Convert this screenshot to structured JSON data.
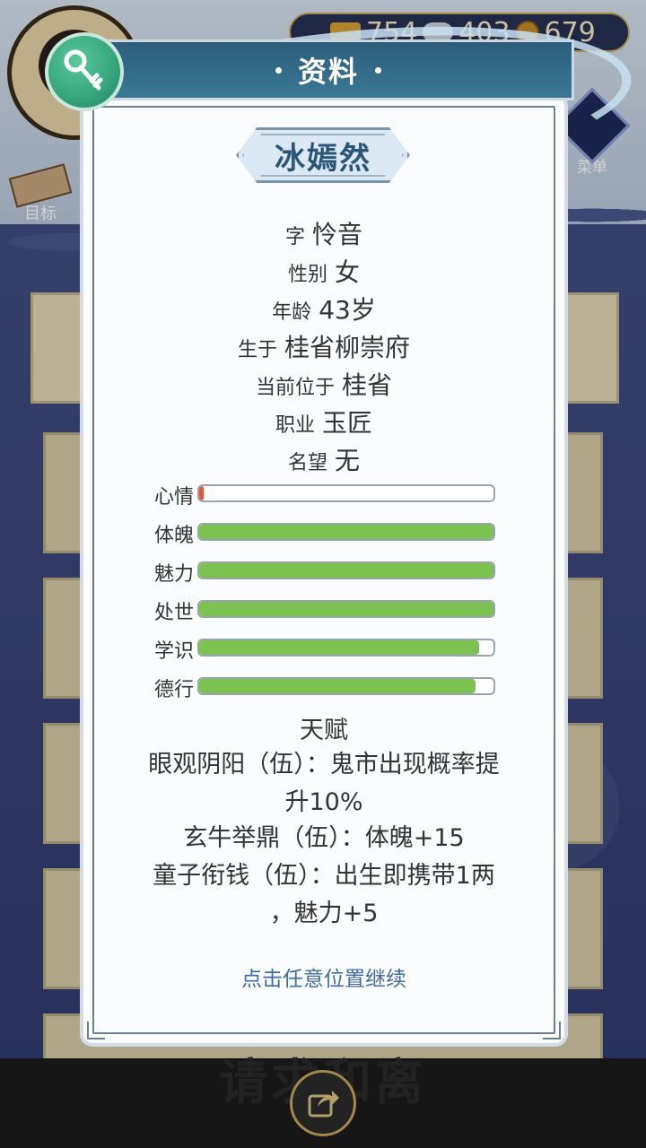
{
  "resources": {
    "gold": "754",
    "silver": "403",
    "coins": "679"
  },
  "background": {
    "menu_label": "菜单",
    "goal_label": "目标",
    "bottom_text": "请求和离"
  },
  "dialog": {
    "title": "资料",
    "name": "冰嫣然",
    "info": [
      {
        "label": "字",
        "value": "怜音"
      },
      {
        "label": "性别",
        "value": "女"
      },
      {
        "label": "年龄",
        "value": "43岁"
      },
      {
        "label": "生于",
        "value": "桂省柳崇府"
      },
      {
        "label": "当前位于",
        "value": "桂省"
      },
      {
        "label": "职业",
        "value": "玉匠"
      },
      {
        "label": "名望",
        "value": "无"
      }
    ],
    "stats": [
      {
        "label": "心情",
        "fraction": 0.01,
        "color": "#e0583e"
      },
      {
        "label": "体魄",
        "fraction": 1.0,
        "color": "#7cc250"
      },
      {
        "label": "魅力",
        "fraction": 1.0,
        "color": "#7cc250"
      },
      {
        "label": "处世",
        "fraction": 1.0,
        "color": "#7cc250"
      },
      {
        "label": "学识",
        "fraction": 0.95,
        "color": "#7cc250"
      },
      {
        "label": "德行",
        "fraction": 0.94,
        "color": "#7cc250"
      }
    ],
    "talent_title": "天赋",
    "talents": [
      {
        "line1": "眼观阴阳（伍）：鬼市出现概率提",
        "line2": "升10%"
      },
      {
        "line1": "玄牛举鼎（伍）：体魄+15",
        "line2": ""
      },
      {
        "line1": "童子衔钱（伍）：出生即携带1两",
        "line2": "，魅力+5"
      }
    ],
    "continue_hint": "点击任意位置继续"
  }
}
